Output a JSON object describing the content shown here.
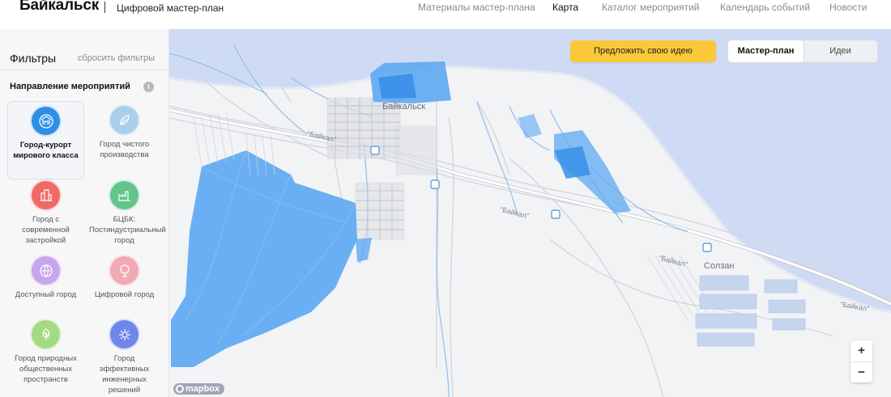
{
  "header": {
    "brand": "Байкальск",
    "subtitle": "Цифровой мастер-план",
    "nav": [
      {
        "label": "Материалы мастер-плана",
        "active": false
      },
      {
        "label": "Карта",
        "active": true
      },
      {
        "label": "Каталог мероприятий",
        "active": false
      },
      {
        "label": "Календарь событий",
        "active": false
      },
      {
        "label": "Новости",
        "active": false
      }
    ]
  },
  "sidebar": {
    "title": "Фильтры",
    "reset": "сбросить фильтры",
    "section_title": "Направление мероприятий",
    "info_icon": "i",
    "categories": [
      {
        "label": "Город-курорт мирового класса",
        "color": "#2f8fe8",
        "icon": "resort-icon",
        "selected": true
      },
      {
        "label": "Город чистого производства",
        "color": "#a9cfe9",
        "icon": "leaf-icon",
        "selected": false
      },
      {
        "label": "Город с современной застройкой",
        "color": "#ee6a66",
        "icon": "buildings-icon",
        "selected": false
      },
      {
        "label": "БЦБК: Постиндустриальный город",
        "color": "#63c58c",
        "icon": "factory-icon",
        "selected": false
      },
      {
        "label": "Доступный город",
        "color": "#c8a6ec",
        "icon": "globe-icon",
        "selected": false
      },
      {
        "label": "Цифровой город",
        "color": "#f1a9b6",
        "icon": "digital-icon",
        "selected": false
      },
      {
        "label": "Город природных общественных пространств",
        "color": "#a4da83",
        "icon": "tree-icon",
        "selected": false
      },
      {
        "label": "Город эффективных инженерных решений",
        "color": "#6e87e8",
        "icon": "gear-icon",
        "selected": false
      }
    ]
  },
  "map": {
    "propose_button": "Предложить свою идею",
    "toggle": [
      {
        "label": "Мастер-план",
        "active": true
      },
      {
        "label": "Идеи",
        "active": false
      }
    ],
    "zoom_in": "+",
    "zoom_out": "−",
    "labels": {
      "city": "Байкальск",
      "solzan": "Солзан",
      "road_1": "“Байкал”",
      "road_2": "“Байкал”",
      "road_3": "“Байкал”",
      "road_4": "“Байкал”"
    },
    "attribution": "mapbox",
    "colors": {
      "water": "#cfdbf4",
      "land": "#f2f3f5",
      "overlay": "#5ea9f2",
      "overlay_dark": "#3a8fe8",
      "rivers": "#8ebff0"
    }
  }
}
